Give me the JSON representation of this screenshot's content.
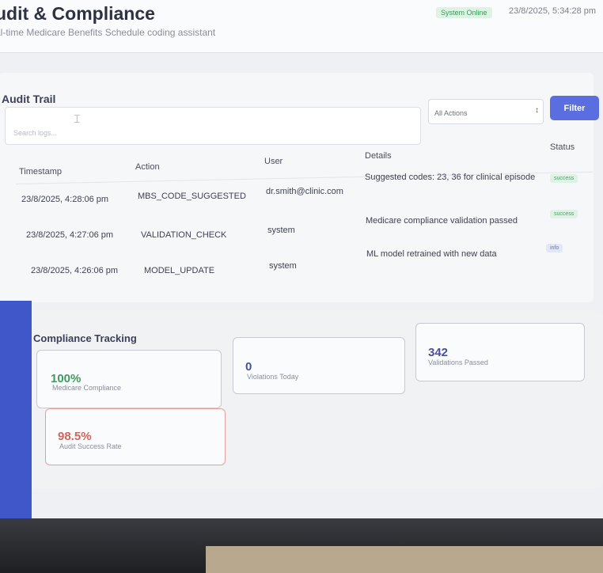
{
  "header": {
    "title": "udit & Compliance",
    "subtitle": "al-time Medicare Benefits Schedule coding assistant",
    "status": "System Online",
    "datetime": "23/8/2025, 5:34:28 pm"
  },
  "audit_trail": {
    "title": "Audit Trail",
    "search_placeholder": "Search logs...",
    "filter_select_value": "All Actions",
    "filter_button": "Filter",
    "columns": [
      "Timestamp",
      "Action",
      "User",
      "Details",
      "Status"
    ],
    "rows": [
      {
        "timestamp": "23/8/2025, 4:28:06 pm",
        "action": "MBS_CODE_SUGGESTED",
        "user": "dr.smith@clinic.com",
        "details": "Suggested codes: 23, 36 for clinical episode",
        "status": "success"
      },
      {
        "timestamp": "23/8/2025, 4:27:06 pm",
        "action": "VALIDATION_CHECK",
        "user": "system",
        "details": "Medicare compliance validation passed",
        "status": "success"
      },
      {
        "timestamp": "23/8/2025, 4:26:06 pm",
        "action": "MODEL_UPDATE",
        "user": "system",
        "details": "ML model retrained with new data",
        "status": "info"
      }
    ]
  },
  "compliance": {
    "title": "Compliance Tracking",
    "cards": [
      {
        "value": "100%",
        "label": "Medicare Compliance",
        "color": "#3f9a5e"
      },
      {
        "value": "0",
        "label": "Violations Today",
        "color": "#4a4f9c"
      },
      {
        "value": "342",
        "label": "Validations Passed",
        "color": "#4a4f9c"
      },
      {
        "value": "98.5%",
        "label": "Audit Success Rate",
        "color": "#d0645a"
      }
    ]
  },
  "colors": {
    "accent": "#5a6ee0",
    "success": "#4aa36a",
    "danger": "#d0645a"
  }
}
